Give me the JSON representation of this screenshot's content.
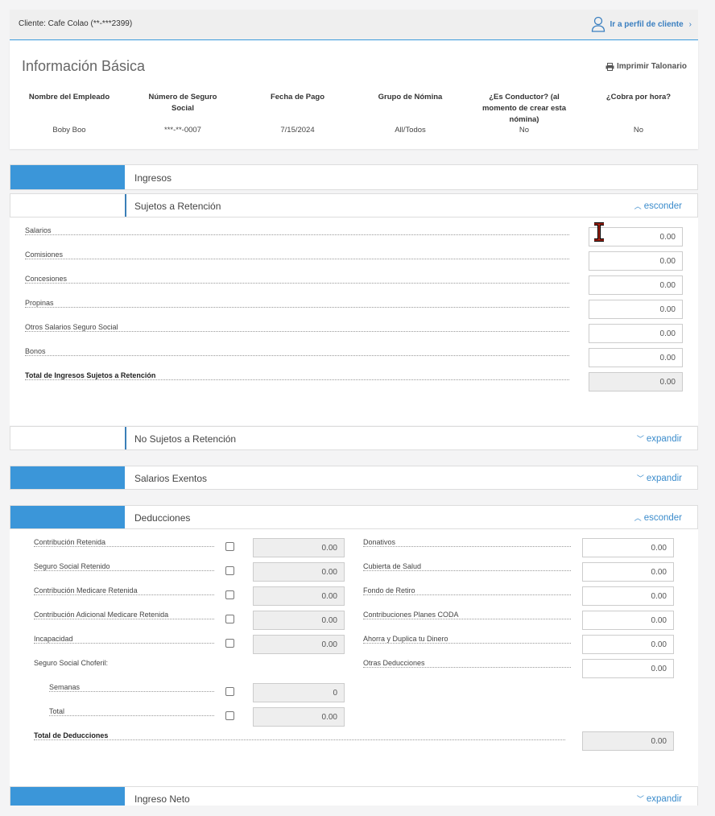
{
  "header": {
    "client_label": "Cliente: Cafe Colao (**-***2399)",
    "profile_link": "Ir a perfil de cliente"
  },
  "basic": {
    "title": "Información Básica",
    "print_label": "Imprimir Talonario",
    "columns": [
      {
        "header": "Nombre del Empleado",
        "value": "Boby Boo"
      },
      {
        "header": "Número de Seguro Social",
        "value": "***-**-0007"
      },
      {
        "header": "Fecha de Pago",
        "value": "7/15/2024"
      },
      {
        "header": "Grupo de Nómina",
        "value": "All/Todos"
      },
      {
        "header": "¿Es Conductor? (al momento de crear esta nómina)",
        "value": "No"
      },
      {
        "header": "¿Cobra por hora?",
        "value": "No"
      }
    ]
  },
  "sections": {
    "ingresos": {
      "label": "Ingresos"
    },
    "sujetos": {
      "label": "Sujetos a Retención",
      "toggle": "esconder"
    },
    "no_sujetos": {
      "label": "No Sujetos a Retención",
      "toggle": "expandir"
    },
    "exentos": {
      "label": "Salarios Exentos",
      "toggle": "expandir"
    },
    "deducciones": {
      "label": "Deducciones",
      "toggle": "esconder"
    },
    "neto": {
      "label": "Ingreso Neto",
      "toggle": "expandir"
    }
  },
  "sujetos_rows": [
    {
      "label": "Salarios",
      "value": "0.00"
    },
    {
      "label": "Comisiones",
      "value": "0.00"
    },
    {
      "label": "Concesiones",
      "value": "0.00"
    },
    {
      "label": "Propinas",
      "value": "0.00"
    },
    {
      "label": "Otros Salarios Seguro Social",
      "value": "0.00"
    },
    {
      "label": "Bonos",
      "value": "0.00"
    },
    {
      "label": "Total de Ingresos Sujetos a Retención",
      "value": "0.00"
    }
  ],
  "deducciones_left": [
    {
      "label": "Contribución Retenida",
      "value": "0.00"
    },
    {
      "label": "Seguro Social Retenido",
      "value": "0.00"
    },
    {
      "label": "Contribución Medicare Retenida",
      "value": "0.00"
    },
    {
      "label": "Contribución Adicional Medicare Retenida",
      "value": "0.00"
    },
    {
      "label": "Incapacidad",
      "value": "0.00"
    },
    {
      "label": "Seguro Social Choferil:"
    },
    {
      "label": "Semanas",
      "value": "0"
    },
    {
      "label": "Total",
      "value": "0.00"
    },
    {
      "label": "Total de Deducciones",
      "value": "0.00"
    }
  ],
  "deducciones_right": [
    {
      "label": "Donativos",
      "value": "0.00"
    },
    {
      "label": "Cubierta de Salud",
      "value": "0.00"
    },
    {
      "label": "Fondo de Retiro",
      "value": "0.00"
    },
    {
      "label": "Contribuciones Planes CODA",
      "value": "0.00"
    },
    {
      "label": "Ahorra y Duplica tu Dinero",
      "value": "0.00"
    },
    {
      "label": "Otras Deducciones",
      "value": "0.00"
    }
  ],
  "colors": {
    "accent": "#3b96d9",
    "link": "#3b8ccc"
  }
}
